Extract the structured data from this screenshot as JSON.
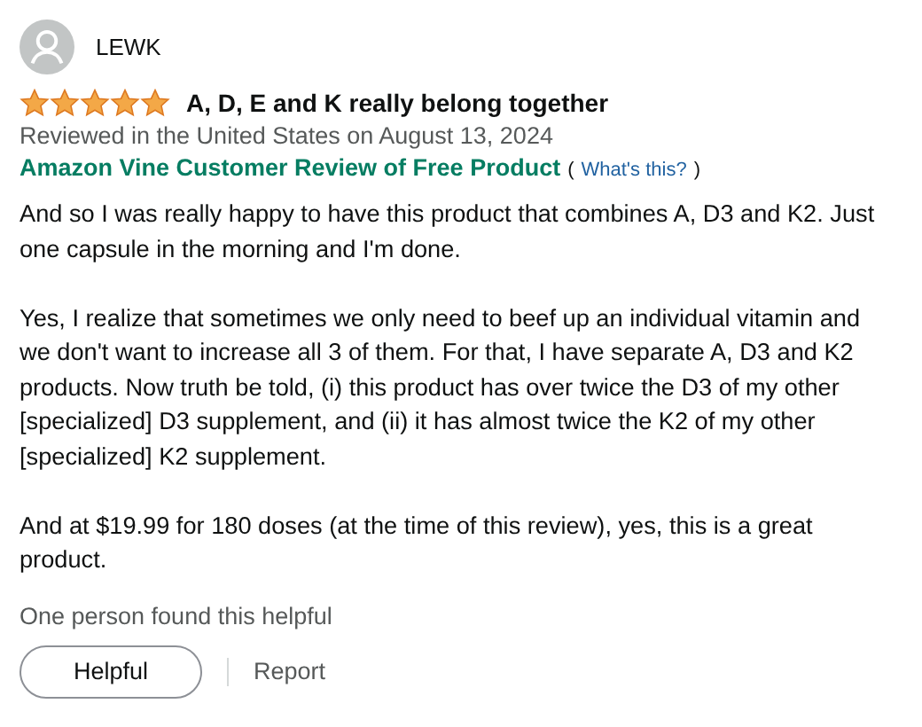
{
  "review": {
    "author": "LEWK",
    "stars": 5,
    "title": "A, D, E and K really belong together",
    "meta": "Reviewed in the United States on August 13, 2024",
    "badge": "Amazon Vine Customer Review of Free Product",
    "whats_this": {
      "open": "(",
      "link": "What's this?",
      "close": ")"
    },
    "paragraphs": [
      "And so I was really happy to have this product that combines A, D3 and K2. Just one capsule in the morning and I'm done.",
      "Yes, I realize that sometimes we only need to beef up an individual vitamin and we don't want to increase all 3 of them. For that, I have separate A, D3 and K2 products. Now truth be told, (i) this product has over twice the D3 of my other [specialized] D3 supplement, and (ii) it has almost twice the K2 of my other [specialized] K2 supplement.",
      "And at $19.99 for 180 doses (at the time of this review), yes, this is a great product."
    ],
    "helpful_count": "One person found this helpful",
    "helpful_button": "Helpful",
    "report_link": "Report"
  }
}
